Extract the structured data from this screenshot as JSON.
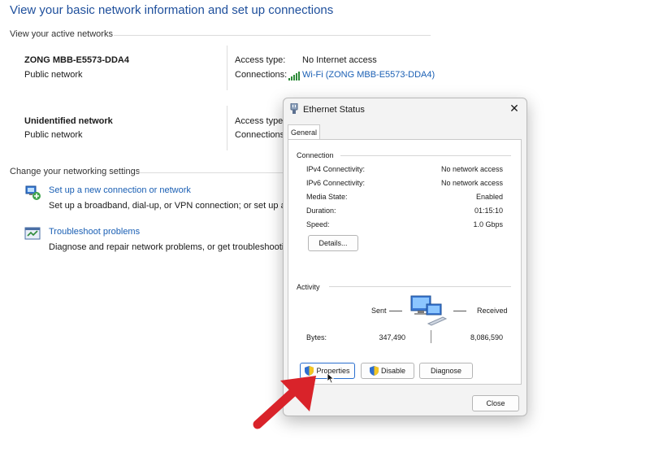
{
  "page_title": "View your basic network information and set up connections",
  "active_networks_header": "View your active networks",
  "networks": [
    {
      "name": "ZONG MBB-E5573-DDA4",
      "type": "Public network",
      "access_type_label": "Access type:",
      "access_type_value": "No Internet access",
      "connections_label": "Connections:",
      "connection_value": "Wi-Fi (ZONG MBB-E5573-DDA4)"
    },
    {
      "name": "Unidentified network",
      "type": "Public network",
      "access_type_label": "Access type:",
      "connections_label": "Connections:"
    }
  ],
  "settings_header": "Change your networking settings",
  "tasks": [
    {
      "link": "Set up a new connection or network",
      "desc": "Set up a broadband, dial-up, or VPN connection; or set up a r"
    },
    {
      "link": "Troubleshoot problems",
      "desc": "Diagnose and repair network problems, or get troubleshootin"
    }
  ],
  "dialog": {
    "title": "Ethernet Status",
    "tab": "General",
    "connection_header": "Connection",
    "rows": [
      {
        "label": "IPv4 Connectivity:",
        "value": "No network access"
      },
      {
        "label": "IPv6 Connectivity:",
        "value": "No network access"
      },
      {
        "label": "Media State:",
        "value": "Enabled"
      },
      {
        "label": "Duration:",
        "value": "01:15:10"
      },
      {
        "label": "Speed:",
        "value": "1.0 Gbps"
      }
    ],
    "details_button": "Details...",
    "activity_header": "Activity",
    "sent_label": "Sent",
    "received_label": "Received",
    "bytes_label": "Bytes:",
    "bytes_sent": "347,490",
    "bytes_received": "8,086,590",
    "properties_button": "Properties",
    "disable_button": "Disable",
    "diagnose_button": "Diagnose",
    "close_button": "Close"
  },
  "colors": {
    "link": "#1a5fb4",
    "arrow": "#d9232a",
    "title": "#1e4f9c"
  },
  "icons": [
    "wifi-signal-icon",
    "setup-connection-icon",
    "troubleshoot-icon",
    "ethernet-icon",
    "close-icon",
    "shield-icon",
    "network-computers-icon",
    "cursor-icon",
    "red-arrow"
  ]
}
